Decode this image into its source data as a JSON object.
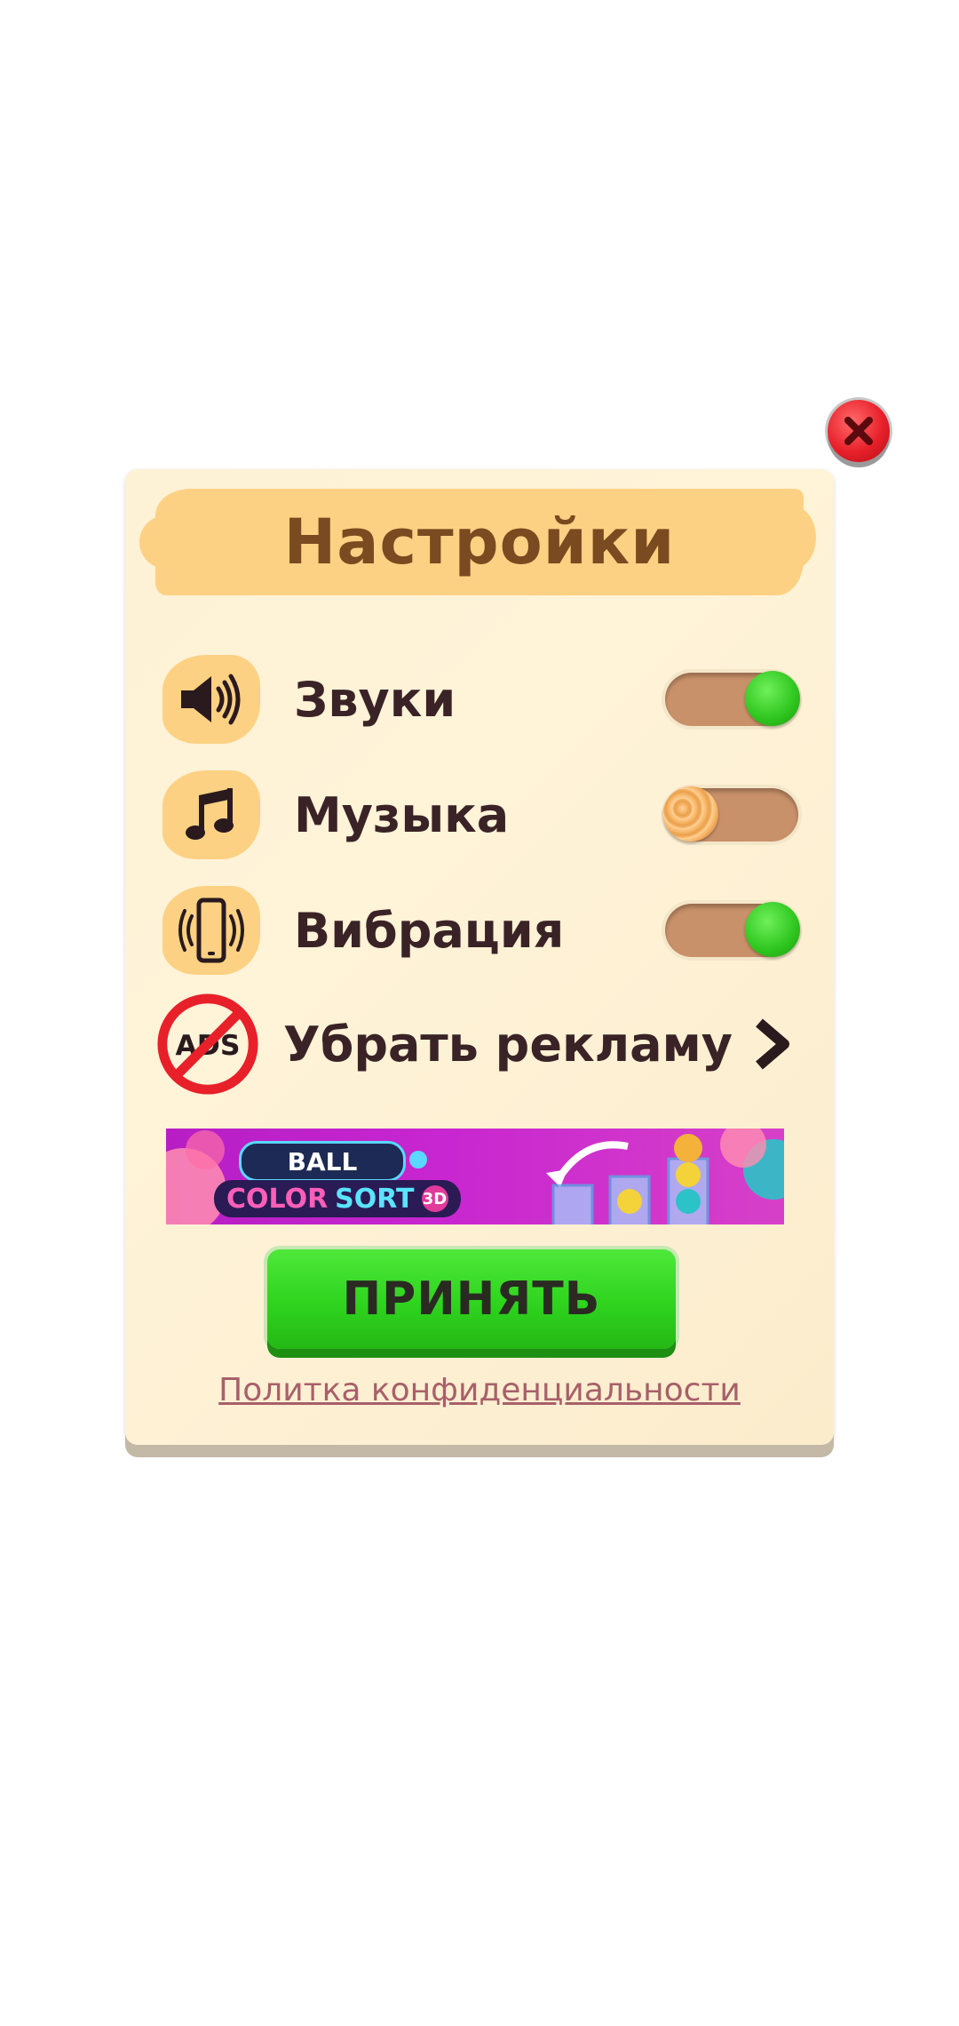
{
  "dialog": {
    "title": "Настройки",
    "close_icon": "close-icon",
    "colors": {
      "panel_bg": "#fdf1d6",
      "title_stroke": "#fdd183",
      "title_text": "#7a4a20",
      "toggle_on": "#2ec51e",
      "toggle_off_knob": "#f7b565",
      "close_red": "#e8202a",
      "accept_green": "#2ed41e",
      "link": "#a8606a"
    }
  },
  "settings": [
    {
      "label": "Звуки",
      "icon": "speaker-icon",
      "enabled": true
    },
    {
      "label": "Музыка",
      "icon": "music-note-icon",
      "enabled": false
    },
    {
      "label": "Вибрация",
      "icon": "phone-vibration-icon",
      "enabled": true
    }
  ],
  "remove_ads": {
    "label": "Убрать рекламу",
    "icon": "no-ads-icon",
    "icon_text": "ADS",
    "chevron_icon": "chevron-right-icon"
  },
  "banner": {
    "line1": "BALL",
    "line2_a": "COLOR",
    "line2_b": "SORT",
    "badge": "3D"
  },
  "accept_button": {
    "label": "ПРИНЯТЬ"
  },
  "privacy_link": {
    "label": "Политка конфиденциальности"
  }
}
